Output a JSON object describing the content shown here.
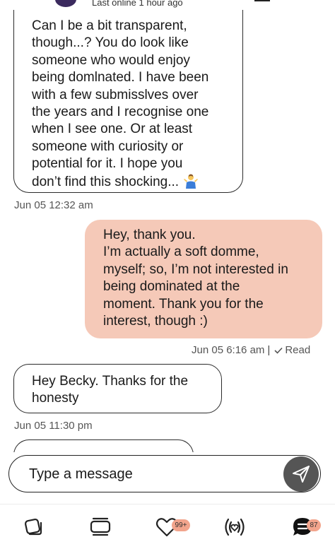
{
  "header": {
    "status": "Last online 1 hour ago"
  },
  "messages": {
    "incoming_1": {
      "lines": [
        "Can I be a bit transparent,",
        "though...? You do look like",
        "someone who would enjoy",
        "being domlnated. I have been",
        "with a few submisslves  over",
        "the years and I recognise one",
        "when I see one. Or at least",
        "someone with curiosity or",
        "potential for it. I hope you",
        "don’t find this shocking..."
      ],
      "emoji": "person-shrugging-emoji",
      "time": "Jun 05 12:32 am"
    },
    "outgoing_1": {
      "lines": [
        "Hey, thank you.",
        "I’m actually a soft domme,",
        "myself; so, I’m not interested in",
        "being dominated at the",
        "moment. Thank you for the",
        "interest, though :)"
      ],
      "time": "Jun 05 6:16 am",
      "separator": "|",
      "read_label": "Read"
    },
    "incoming_2": {
      "lines": [
        "Hey Becky. Thanks for the",
        "honesty"
      ],
      "time": "Jun 05 11:30 pm"
    }
  },
  "composer": {
    "placeholder": "Type a message"
  },
  "nav": {
    "likes_badge": "99+",
    "messages_badge": "87"
  },
  "colors": {
    "outgoing_bubble": "#f5c9b8",
    "send_button": "#555555",
    "badge": "#f2a48c"
  }
}
